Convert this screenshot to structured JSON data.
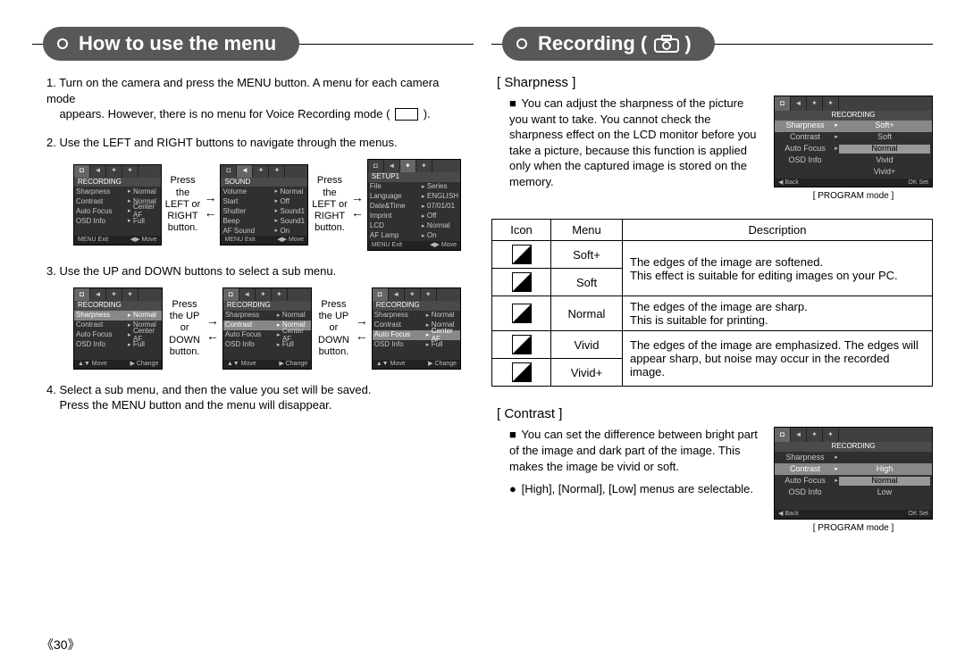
{
  "left": {
    "title": "How to use the menu",
    "steps": {
      "s1a": "1. Turn on the camera and press the MENU button. A menu for each camera mode",
      "s1b": "appears. However, there is no menu for Voice Recording mode (",
      "s1c": ").",
      "s2": "2. Use the LEFT and RIGHT buttons to navigate through the menus.",
      "s3": "3. Use the UP and DOWN buttons to select a sub menu.",
      "s4a": "4. Select a sub menu, and then the value you set will be saved.",
      "s4b": "Press the MENU button and the menu will disappear."
    },
    "between_lr": "Press the LEFT or RIGHT button.",
    "between_ud": "Press the UP or DOWN button.",
    "lcd_recording": {
      "section": "RECORDING",
      "r1k": "Sharpness",
      "r1v": "Normal",
      "r2k": "Contrast",
      "r2v": "Normal",
      "r3k": "Auto Focus",
      "r3v": "Center AF",
      "r4k": "OSD Info",
      "r4v": "Full",
      "foot_l": "MENU  Exit",
      "foot_r": "◀▶  Move"
    },
    "lcd_sound": {
      "section": "SOUND",
      "r1k": "Volume",
      "r1v": "Normal",
      "r2k": "Start",
      "r2v": "Off",
      "r3k": "Shutter",
      "r3v": "Sound1",
      "r4k": "Beep",
      "r4v": "Sound1",
      "r5k": "AF Sound",
      "r5v": "On",
      "foot_l": "MENU  Exit",
      "foot_r": "◀▶  Move"
    },
    "lcd_setup": {
      "section": "SETUP1",
      "r1k": "File",
      "r1v": "Series",
      "r2k": "Language",
      "r2v": "ENGLISH",
      "r3k": "Date&Time",
      "r3v": "07/01/01",
      "r4k": "Imprint",
      "r4v": "Off",
      "r5k": "LCD",
      "r5v": "Normal",
      "r6k": "AF Lamp",
      "r6v": "On",
      "foot_l": "MENU  Exit",
      "foot_r": "◀▶  Move"
    },
    "lcd_recording2_foot_l": "▲▼  Move",
    "lcd_recording2_foot_r": "▶  Change"
  },
  "right": {
    "title": "Recording (",
    "title_end": ")",
    "sharp_head": "[ Sharpness ]",
    "sharp_para": "You can adjust the sharpness of the picture you want to take. You cannot check the sharpness effect on the LCD monitor before you take a picture, because this function is applied only when the captured image is stored on the memory.",
    "sharp_caption": "[ PROGRAM mode ]",
    "lcd_sharp": {
      "section": "RECORDING",
      "r1k": "Sharpness",
      "opt1": "Soft+",
      "r2k": "Contrast",
      "opt2": "Soft",
      "r3k": "Auto Focus",
      "opt3": "Normal",
      "r4k": "OSD Info",
      "opt4": "Vivid",
      "opt5": "Vivid+",
      "foot_l": "◀  Back",
      "foot_r": "OK  Set"
    },
    "table": {
      "h_icon": "Icon",
      "h_menu": "Menu",
      "h_desc": "Description",
      "m1": "Soft+",
      "d1": "The edges of the image are softened.",
      "m2": "Soft",
      "d2": "This effect is suitable for editing images on your PC.",
      "m3": "Normal",
      "d3a": "The edges of the image are sharp.",
      "d3b": "This is suitable for printing.",
      "m4": "Vivid",
      "d4a": "The edges of the image are emphasized. The edges will appear sharp, but noise may occur in the recorded image.",
      "m5": "Vivid+"
    },
    "contrast_head": "[ Contrast ]",
    "contrast_para": "You can set the difference between bright part of the image and dark part of the image. This makes the image be vivid or soft.",
    "contrast_bullet": "[High], [Normal], [Low] menus are selectable.",
    "contrast_caption": "[ PROGRAM mode ]",
    "lcd_contrast": {
      "section": "RECORDING",
      "r1k": "Sharpness",
      "opt1": "High",
      "r2k": "Contrast",
      "opt2": "Normal",
      "r3k": "Auto Focus",
      "opt3": "Low",
      "r4k": "OSD Info",
      "foot_l": "◀  Back",
      "foot_r": "OK  Set"
    }
  },
  "pagenum": "《30》"
}
